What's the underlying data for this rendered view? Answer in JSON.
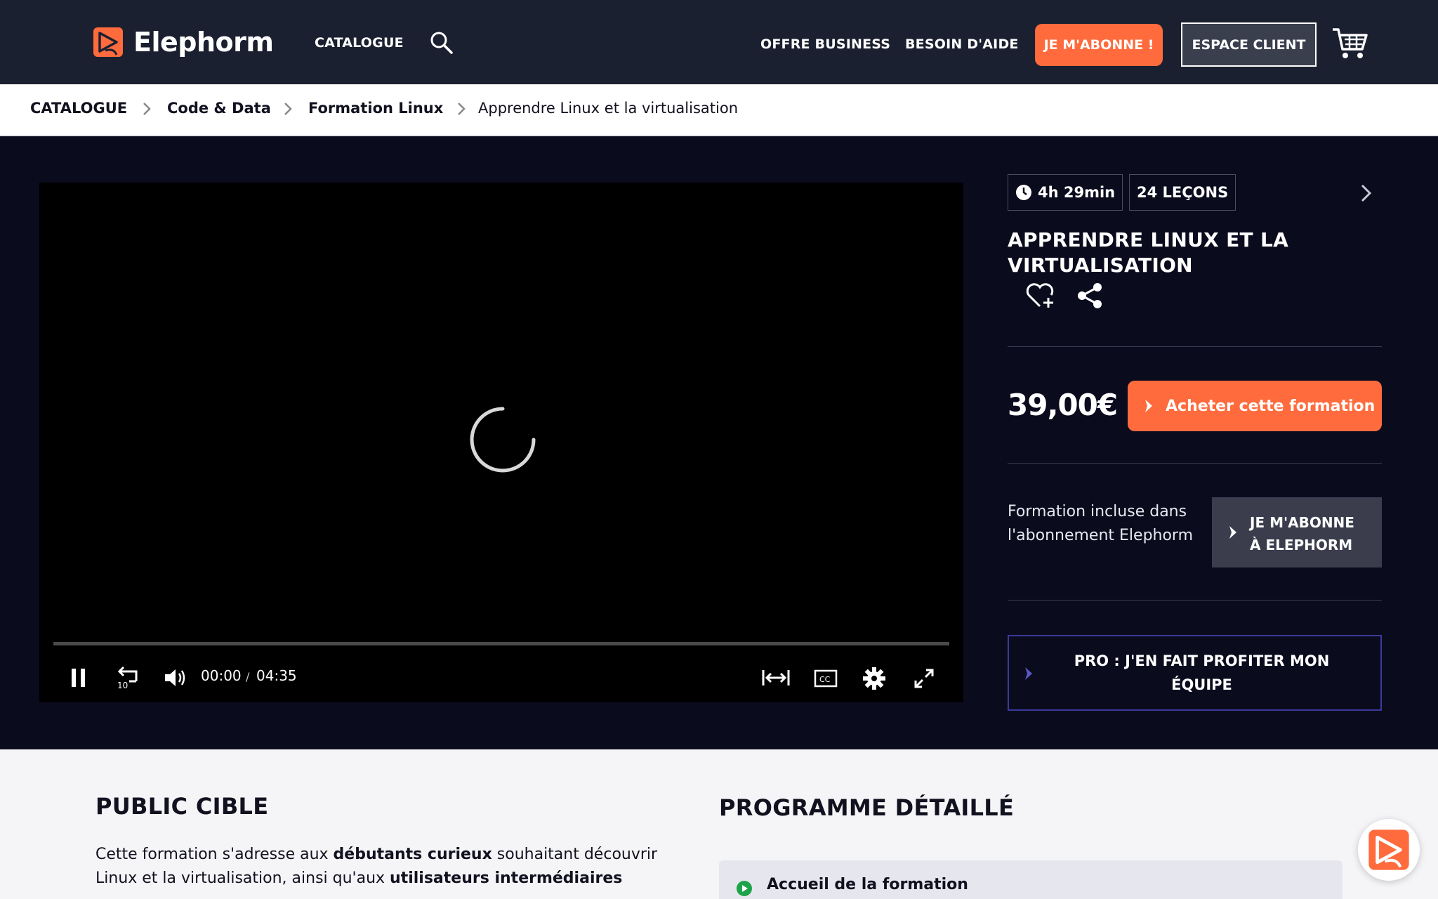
{
  "header": {
    "brand": "Elephorm",
    "nav_catalogue": "CATALOGUE",
    "nav_offre": "OFFRE BUSINESS",
    "nav_aide": "BESOIN D'AIDE",
    "subscribe_label": "JE M'ABONNE !",
    "client_label": "ESPACE CLIENT",
    "accent_color": "#ff6b3d"
  },
  "breadcrumb": {
    "items": [
      "CATALOGUE",
      "Code & Data",
      "Formation Linux",
      "Apprendre Linux et la virtualisation"
    ]
  },
  "player": {
    "current_time": "00:00",
    "separator": "/",
    "duration": "04:35",
    "progress": 0
  },
  "course": {
    "duration_chip": "4h 29min",
    "lessons_chip": "24 LEÇONS",
    "title_line1": "APPRENDRE LINUX ET LA",
    "title_line2": "VIRTUALISATION",
    "price": "39,00€",
    "buy_label": "Acheter cette formation",
    "included_text": "Formation incluse dans l'abonnement Elephorm",
    "subscribe_line1": "JE M'ABONNE",
    "subscribe_line2": "À ELEPHORM",
    "pro_line1": "PRO : J'EN FAIT PROFITER MON",
    "pro_line2": "ÉQUIPE"
  },
  "content": {
    "public_title": "PUBLIC CIBLE",
    "public_p1": "Cette formation s'adresse aux ",
    "public_b1": "débutants curieux",
    "public_p2": " souhaitant découvrir",
    "public_p3": "Linux et la virtualisation, ainsi qu'aux ",
    "public_b2": "utilisateurs intermédiaires",
    "programme_title": "PROGRAMME DÉTAILLÉ",
    "programme_item": "Accueil de la formation"
  }
}
